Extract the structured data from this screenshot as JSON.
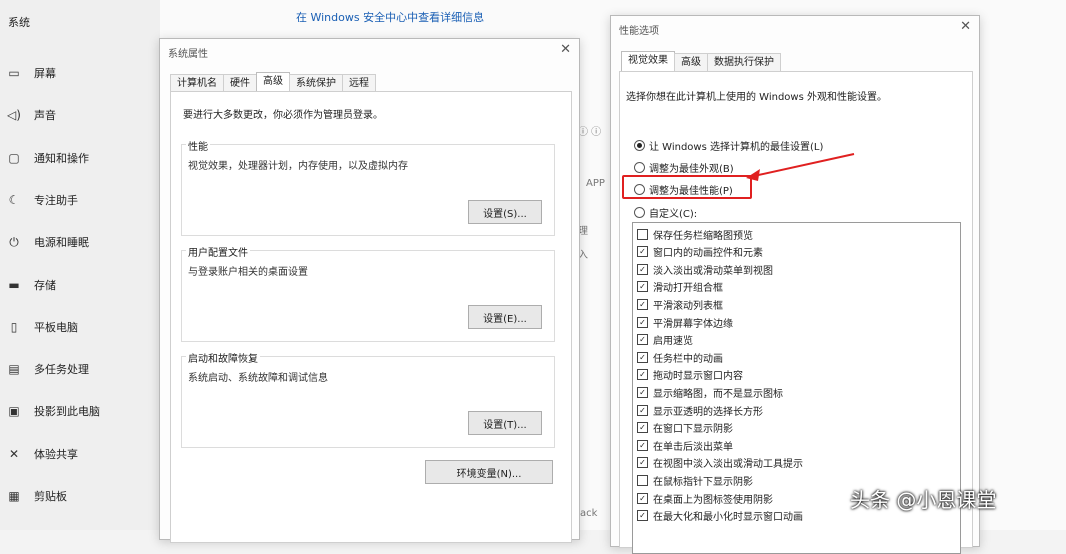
{
  "settings": {
    "header": "系统",
    "link": "在 Windows 安全中心中查看详细信息",
    "nav": [
      {
        "label": "屏幕",
        "icon": "monitor-icon"
      },
      {
        "label": "声音",
        "icon": "speaker-icon"
      },
      {
        "label": "通知和操作",
        "icon": "notification-icon"
      },
      {
        "label": "专注助手",
        "icon": "moon-icon"
      },
      {
        "label": "电源和睡眠",
        "icon": "power-icon"
      },
      {
        "label": "存储",
        "icon": "storage-icon"
      },
      {
        "label": "平板电脑",
        "icon": "tablet-icon"
      },
      {
        "label": "多任务处理",
        "icon": "multitask-icon"
      },
      {
        "label": "投影到此电脑",
        "icon": "projector-icon"
      },
      {
        "label": "体验共享",
        "icon": "share-icon"
      },
      {
        "label": "剪贴板",
        "icon": "clipboard-icon"
      }
    ],
    "fragments": [
      "APP",
      "理",
      "入",
      "ack"
    ]
  },
  "sysprops": {
    "title": "系统属性",
    "tabs": [
      "计算机名",
      "硬件",
      "高级",
      "系统保护",
      "远程"
    ],
    "active_tab": "高级",
    "admin_note": "要进行大多数更改，你必须作为管理员登录。",
    "groups": [
      {
        "title": "性能",
        "desc": "视觉效果，处理器计划，内存使用，以及虚拟内存",
        "button": "设置(S)..."
      },
      {
        "title": "用户配置文件",
        "desc": "与登录账户相关的桌面设置",
        "button": "设置(E)..."
      },
      {
        "title": "启动和故障恢复",
        "desc": "系统启动、系统故障和调试信息",
        "button": "设置(T)..."
      }
    ],
    "env_button": "环境变量(N)..."
  },
  "perf": {
    "title": "性能选项",
    "tabs": [
      "视觉效果",
      "高级",
      "数据执行保护"
    ],
    "active_tab": "视觉效果",
    "intro": "选择你想在此计算机上使用的 Windows 外观和性能设置。",
    "radios": [
      {
        "label": "让 Windows 选择计算机的最佳设置(L)",
        "checked": true
      },
      {
        "label": "调整为最佳外观(B)",
        "checked": false
      },
      {
        "label": "调整为最佳性能(P)",
        "checked": false
      },
      {
        "label": "自定义(C):",
        "checked": false
      }
    ],
    "checkboxes": [
      {
        "label": "保存任务栏缩略图预览",
        "checked": false
      },
      {
        "label": "窗口内的动画控件和元素",
        "checked": true
      },
      {
        "label": "淡入淡出或滑动菜单到视图",
        "checked": true
      },
      {
        "label": "滑动打开组合框",
        "checked": true
      },
      {
        "label": "平滑滚动列表框",
        "checked": true
      },
      {
        "label": "平滑屏幕字体边缘",
        "checked": true
      },
      {
        "label": "启用速览",
        "checked": true
      },
      {
        "label": "任务栏中的动画",
        "checked": true
      },
      {
        "label": "拖动时显示窗口内容",
        "checked": true
      },
      {
        "label": "显示缩略图，而不是显示图标",
        "checked": true
      },
      {
        "label": "显示亚透明的选择长方形",
        "checked": true
      },
      {
        "label": "在窗口下显示阴影",
        "checked": true
      },
      {
        "label": "在单击后淡出菜单",
        "checked": true
      },
      {
        "label": "在视图中淡入淡出或滑动工具提示",
        "checked": true
      },
      {
        "label": "在鼠标指针下显示阴影",
        "checked": false
      },
      {
        "label": "在桌面上为图标签使用阴影",
        "checked": true
      },
      {
        "label": "在最大化和最小化时显示窗口动画",
        "checked": true
      }
    ],
    "highlight_color": "#e02020"
  },
  "watermark": "头条 @小恩课堂"
}
